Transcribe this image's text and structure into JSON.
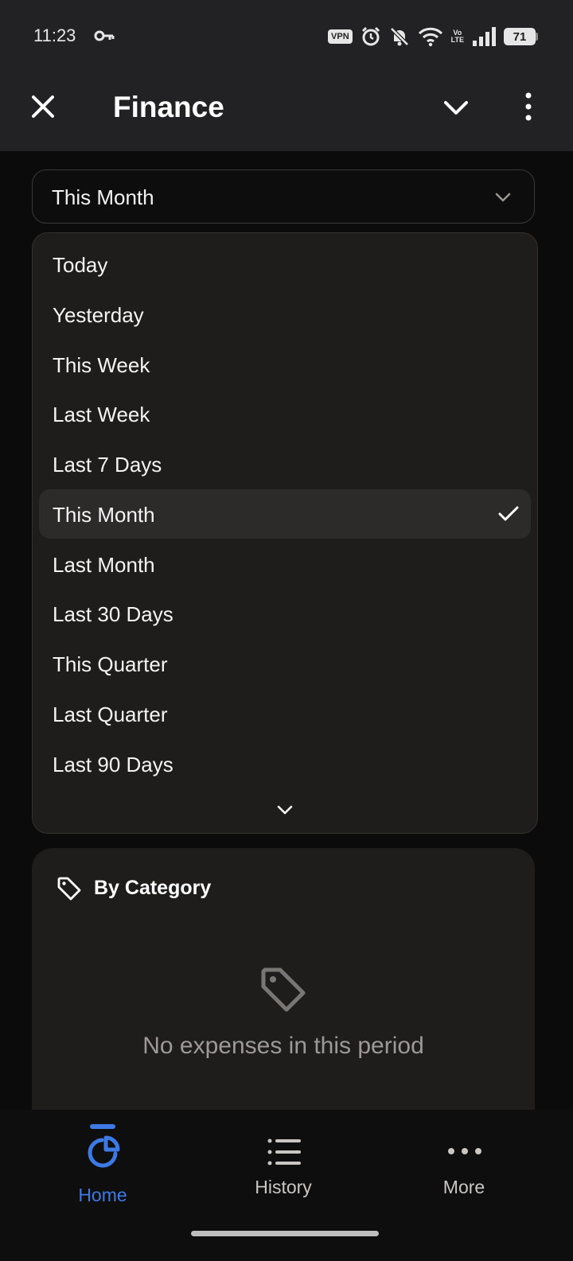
{
  "status_bar": {
    "time": "11:23",
    "vpn_label": "VPN",
    "volte_top": "Vo",
    "volte_bottom": "LTE",
    "battery_level": "71"
  },
  "app_bar": {
    "title": "Finance"
  },
  "period_select": {
    "value": "This Month"
  },
  "dropdown": {
    "options": [
      {
        "label": "Today"
      },
      {
        "label": "Yesterday"
      },
      {
        "label": "This Week"
      },
      {
        "label": "Last Week"
      },
      {
        "label": "Last 7 Days"
      },
      {
        "label": "This Month",
        "selected": true
      },
      {
        "label": "Last Month"
      },
      {
        "label": "Last 30 Days"
      },
      {
        "label": "This Quarter"
      },
      {
        "label": "Last Quarter"
      },
      {
        "label": "Last 90 Days"
      }
    ]
  },
  "category_card": {
    "title": "By Category",
    "empty_message": "No expenses in this period"
  },
  "bottom_nav": {
    "items": [
      {
        "label": "Home",
        "icon": "pie-chart-icon",
        "active": true
      },
      {
        "label": "History",
        "icon": "list-icon"
      },
      {
        "label": "More",
        "icon": "more-horizontal-icon"
      }
    ]
  },
  "colors": {
    "accent": "#3d7ae6",
    "background": "#0c0b0b",
    "surface": "#1f1d1c",
    "app_bar": "#222225"
  }
}
